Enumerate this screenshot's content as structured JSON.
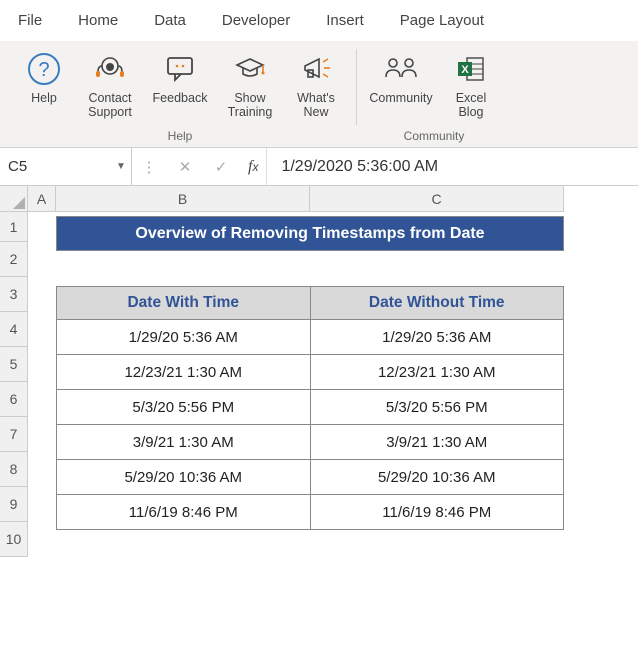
{
  "ribbon": {
    "tabs": [
      "File",
      "Home",
      "Data",
      "Developer",
      "Insert",
      "Page Layout"
    ],
    "group1_name": "Help",
    "group2_name": "Community",
    "btn_help": "Help",
    "btn_contact": "Contact\nSupport",
    "btn_feedback": "Feedback",
    "btn_training": "Show\nTraining",
    "btn_new": "What's\nNew",
    "btn_community": "Community",
    "btn_blog": "Excel\nBlog"
  },
  "formula_bar": {
    "name_box": "C5",
    "formula": "1/29/2020  5:36:00 AM"
  },
  "sheet": {
    "cols": [
      "A",
      "B",
      "C"
    ],
    "rows": [
      "1",
      "2",
      "3",
      "4",
      "5",
      "6",
      "7",
      "8",
      "9",
      "10"
    ],
    "title": "Overview of Removing Timestamps from Date",
    "header_b": "Date With Time",
    "header_c": "Date Without Time",
    "data": [
      {
        "b": "1/29/20 5:36 AM",
        "c": "1/29/20 5:36 AM"
      },
      {
        "b": "12/23/21 1:30 AM",
        "c": "12/23/21 1:30 AM"
      },
      {
        "b": "5/3/20 5:56 PM",
        "c": "5/3/20 5:56 PM"
      },
      {
        "b": "3/9/21 1:30 AM",
        "c": "3/9/21 1:30 AM"
      },
      {
        "b": "5/29/20 10:36 AM",
        "c": "5/29/20 10:36 AM"
      },
      {
        "b": "11/6/19 8:46 PM",
        "c": "11/6/19 8:46 PM"
      }
    ]
  }
}
